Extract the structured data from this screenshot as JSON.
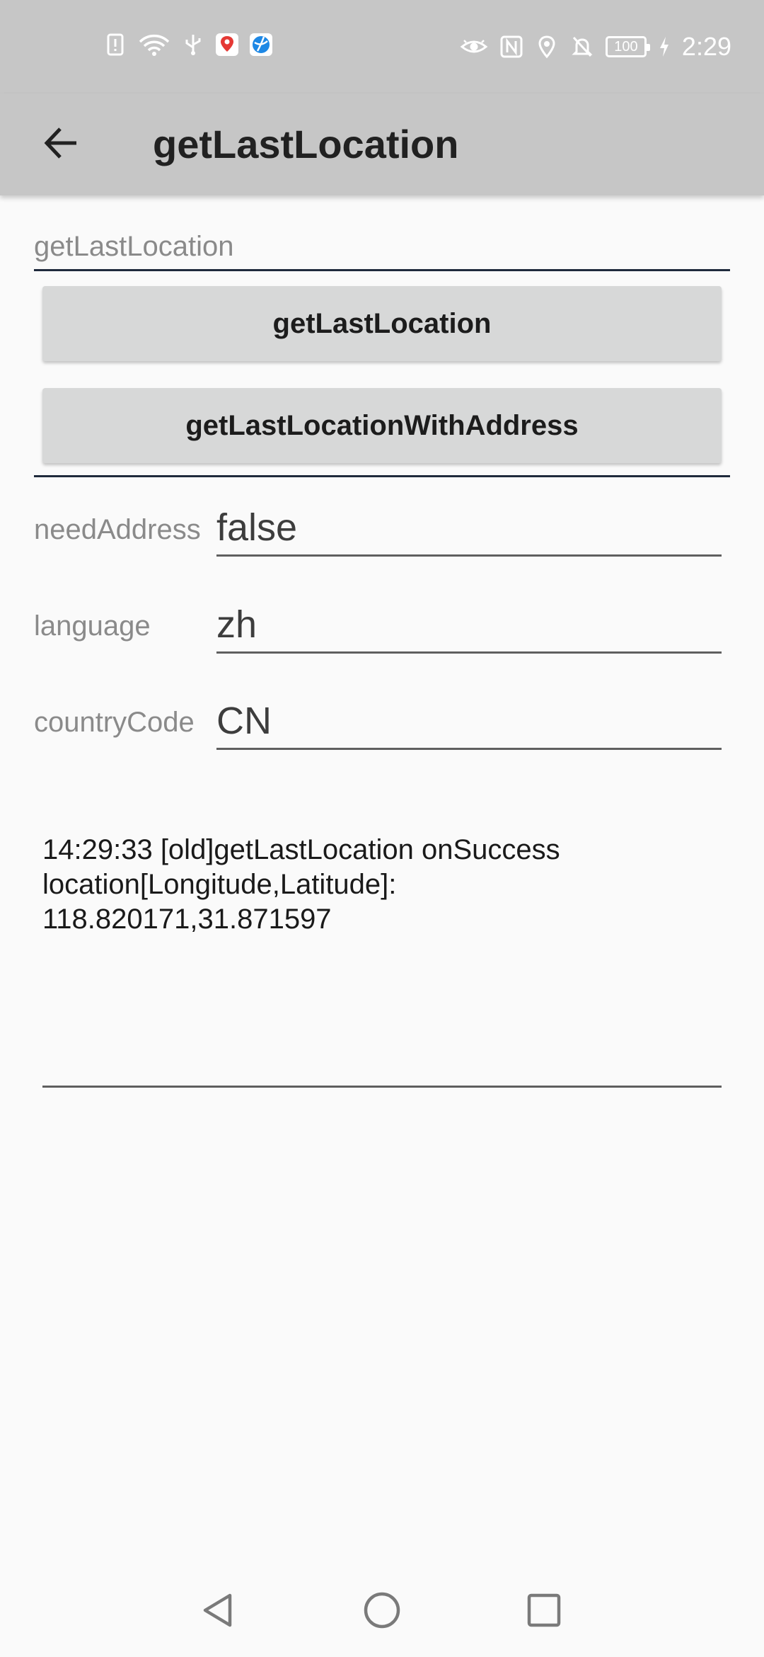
{
  "status_bar": {
    "time": "2:29",
    "battery": "100",
    "left_icons": [
      "sim-alert-icon",
      "wifi-icon",
      "usb-icon",
      "location-app-icon",
      "browser-app-icon"
    ],
    "right_icons": [
      "eye-comfort-icon",
      "nfc-icon",
      "location-icon",
      "mute-icon",
      "battery-icon",
      "charging-icon"
    ]
  },
  "toolbar": {
    "title": "getLastLocation",
    "back_icon": "arrow-back-icon"
  },
  "section": {
    "label": "getLastLocation"
  },
  "buttons": {
    "get_last_location": "getLastLocation",
    "get_last_location_with_address": "getLastLocationWithAddress"
  },
  "form": {
    "need_address": {
      "label": "needAddress",
      "value": "false"
    },
    "language": {
      "label": "language",
      "value": "zh"
    },
    "country_code": {
      "label": "countryCode",
      "value": "CN"
    }
  },
  "log": {
    "lines": [
      "14:29:33 [old]getLastLocation onSuccess",
      "location[Longitude,Latitude]:",
      "118.820171,31.871597"
    ]
  },
  "nav_bar": {
    "icons": [
      "back-triangle-icon",
      "home-circle-icon",
      "recents-square-icon"
    ]
  },
  "colors": {
    "app_bar": "#c6c6c6",
    "background": "#fafafa",
    "button": "#d7d8d8",
    "divider": "#1f2a3c"
  }
}
